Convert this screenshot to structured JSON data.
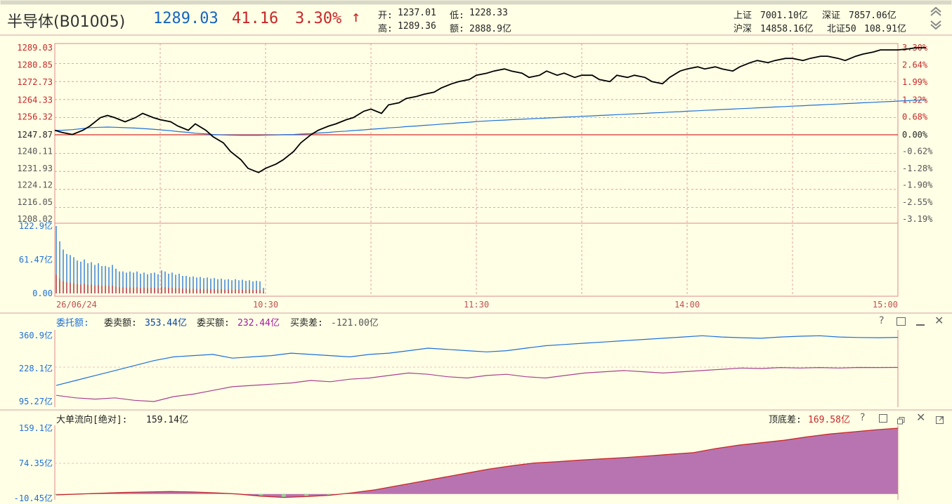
{
  "header": {
    "name": "半导体(B01005)",
    "price": "1289.03",
    "change": "41.16",
    "change_pct": "3.30%",
    "arrow": "↑",
    "open_label": "开:",
    "open": "1237.01",
    "low_label": "低:",
    "low": "1228.33",
    "high_label": "高:",
    "high": "1289.36",
    "amount_label": "额:",
    "amount": "2888.9亿",
    "market": [
      {
        "label": "上证",
        "value": "7001.10亿"
      },
      {
        "label": "深证",
        "value": "7857.06亿"
      },
      {
        "label": "沪深",
        "value": "14858.16亿"
      },
      {
        "label": "北证50",
        "value": "108.91亿"
      }
    ]
  },
  "price_axis_left": [
    "1289.03",
    "1280.85",
    "1272.73",
    "1264.33",
    "1256.32",
    "1247.87",
    "1240.11",
    "1231.93",
    "1224.12",
    "1216.05",
    "1208.02"
  ],
  "price_axis_right": [
    "3.30%",
    "2.64%",
    "1.99%",
    "1.32%",
    "0.68%",
    "0.00%",
    "-0.62%",
    "-1.28%",
    "-1.90%",
    "-2.55%",
    "-3.19%"
  ],
  "volume_axis": [
    "122.9亿",
    "61.47亿",
    "0.00"
  ],
  "time_axis": [
    "26/06/24",
    "10:30",
    "11:30",
    "14:00",
    "15:00"
  ],
  "colors": {
    "price_line": "#000000",
    "avg_line": "#1E6FD9",
    "rise": "#D32F2F",
    "grid": "#E08A8A",
    "bg": "#FFFFE6",
    "vol_blue": "#1E6FD9",
    "vol_red": "#C62828",
    "sell": "#1E6FD9",
    "buy": "#A8428C",
    "flow_fill": "#B874B0",
    "flow_line": "#C62828",
    "flow_neg": "#9BCB9B"
  },
  "panel1": {
    "title": "委托额:",
    "sell_label": "委卖额:",
    "sell_value": "353.44亿",
    "buy_label": "委买额:",
    "buy_value": "232.44亿",
    "diff_label": "买卖差:",
    "diff_value": "-121.00亿",
    "axis": [
      "360.9亿",
      "228.1亿",
      "95.27亿"
    ]
  },
  "panel2": {
    "title": "大单流向[绝对]:",
    "value": "159.14亿",
    "peak_label": "顶底差:",
    "peak_value": "169.58亿",
    "axis": [
      "159.1亿",
      "74.35亿",
      "-10.45亿"
    ]
  },
  "chart_data": [
    {
      "type": "line",
      "title": "半导体(B01005)",
      "xlabel": "",
      "ylabel": "",
      "ylim": [
        1208.02,
        1289.03
      ],
      "x_minutes_from_open": [
        0,
        2,
        5,
        8,
        10,
        13,
        15,
        17,
        20,
        23,
        25,
        28,
        30,
        33,
        35,
        38,
        40,
        43,
        45,
        48,
        50,
        53,
        55,
        58,
        60,
        63,
        65,
        68,
        70,
        73,
        75,
        78,
        80,
        83,
        85,
        88,
        90,
        93,
        95,
        98,
        100,
        103,
        105,
        108,
        110,
        113,
        115,
        118,
        120,
        123,
        125,
        128,
        130,
        133,
        135,
        138,
        140,
        143,
        145,
        148,
        150,
        153,
        155,
        158,
        160,
        163,
        165,
        168,
        170,
        173,
        175,
        178,
        180,
        183,
        185,
        188,
        190,
        193,
        195,
        198,
        200,
        203,
        205,
        208,
        210,
        213,
        215,
        218,
        220,
        223,
        225,
        228,
        230,
        233,
        235,
        238,
        240,
        243,
        245,
        248
      ],
      "series": [
        {
          "name": "",
          "values": [
            1250.0,
            1249.0,
            1248.0,
            1250.0,
            1252.0,
            1256.0,
            1257.0,
            1256.0,
            1254.0,
            1256.0,
            1258.0,
            1256.0,
            1255.0,
            1254.0,
            1252.0,
            1250.0,
            1253.0,
            1250.0,
            1247.0,
            1244.0,
            1240.0,
            1236.0,
            1232.0,
            1230.0,
            1232.0,
            1234.0,
            1236.0,
            1240.0,
            1244.0,
            1248.0,
            1250.0,
            1252.0,
            1253.0,
            1255.0,
            1256.0,
            1259.0,
            1260.0,
            1258.0,
            1262.0,
            1263.0,
            1265.0,
            1266.0,
            1267.0,
            1268.0,
            1270.0,
            1272.0,
            1273.0,
            1274.0,
            1276.0,
            1277.0,
            1278.0,
            1279.0,
            1278.0,
            1277.0,
            1275.0,
            1276.0,
            1278.0,
            1276.0,
            1277.0,
            1275.0,
            1276.0,
            1276.0,
            1274.0,
            1273.0,
            1276.0,
            1275.0,
            1276.0,
            1275.0,
            1273.0,
            1272.0,
            1275.0,
            1278.0,
            1279.0,
            1280.0,
            1279.0,
            1280.0,
            1279.0,
            1278.0,
            1280.0,
            1282.0,
            1283.0,
            1282.0,
            1283.0,
            1284.0,
            1284.0,
            1283.0,
            1284.0,
            1285.0,
            1285.0,
            1284.0,
            1283.0,
            1285.0,
            1286.0,
            1287.0,
            1288.0,
            1288.0,
            1288.0,
            1288.5,
            1289.0,
            1289.03
          ]
        },
        {
          "name": "",
          "values": [
            1250.0,
            1250.0,
            1250.3,
            1250.8,
            1251.2,
            1251.4,
            1251.5,
            1251.4,
            1251.2,
            1251.0,
            1250.8,
            1250.5,
            1250.2,
            1249.8,
            1249.4,
            1249.0,
            1248.6,
            1248.3,
            1248.0,
            1247.8,
            1247.7,
            1247.6,
            1247.6,
            1247.6,
            1247.7,
            1247.8,
            1247.9,
            1248.0,
            1248.2,
            1248.4,
            1248.7,
            1249.0,
            1249.3,
            1249.6,
            1249.9,
            1250.2,
            1250.5,
            1250.8,
            1251.1,
            1251.4,
            1251.7,
            1252.0,
            1252.3,
            1252.6,
            1252.9,
            1253.2,
            1253.5,
            1253.8,
            1254.1,
            1254.4,
            1254.6,
            1254.8,
            1255.0,
            1255.2,
            1255.4,
            1255.6,
            1255.8,
            1256.0,
            1256.2,
            1256.4,
            1256.6,
            1256.8,
            1257.0,
            1257.2,
            1257.4,
            1257.6,
            1257.8,
            1258.0,
            1258.2,
            1258.4,
            1258.6,
            1258.8,
            1259.0,
            1259.2,
            1259.4,
            1259.6,
            1259.8,
            1260.0,
            1260.2,
            1260.4,
            1260.6,
            1260.8,
            1261.0,
            1261.2,
            1261.4,
            1261.6,
            1261.8,
            1262.0,
            1262.2,
            1262.4,
            1262.6,
            1262.8,
            1263.0,
            1263.2,
            1263.4,
            1263.6,
            1263.8,
            1264.0,
            1264.2,
            1264.4
          ]
        }
      ]
    },
    {
      "type": "bar",
      "ylim": [
        0,
        122.9
      ],
      "series": [
        {
          "name": "",
          "values": [
            122.9,
            95,
            80,
            72,
            70,
            66,
            60,
            58,
            62,
            55,
            57,
            52,
            55,
            50,
            50,
            48,
            52,
            45,
            40,
            40,
            38,
            40,
            38,
            40,
            36,
            38,
            35,
            37,
            38,
            35,
            42,
            40,
            36,
            38,
            34,
            36,
            32,
            32,
            30,
            31,
            29,
            30,
            28,
            29,
            27,
            28,
            26,
            27,
            25,
            26,
            24,
            26,
            24,
            25,
            23,
            24,
            22,
            23,
            22,
            10
          ]
        }
      ]
    },
    {
      "type": "line",
      "ylim": [
        95.27,
        360.9
      ],
      "series": [
        {
          "name": "委卖额",
          "values": [
            160,
            180,
            200,
            220,
            240,
            260,
            275,
            280,
            285,
            270,
            275,
            280,
            290,
            285,
            280,
            275,
            285,
            290,
            300,
            310,
            305,
            300,
            295,
            300,
            310,
            320,
            325,
            330,
            335,
            340,
            345,
            350,
            355,
            360,
            355,
            352,
            350,
            355,
            358,
            360,
            355,
            353,
            352,
            353.44
          ]
        },
        {
          "name": "委买额",
          "values": [
            120,
            110,
            105,
            110,
            100,
            95.27,
            115,
            125,
            140,
            155,
            160,
            165,
            170,
            180,
            175,
            185,
            190,
            200,
            210,
            205,
            195,
            190,
            200,
            205,
            195,
            190,
            200,
            210,
            215,
            220,
            215,
            210,
            215,
            220,
            225,
            230,
            228,
            232,
            230,
            232,
            230,
            232.44,
            232,
            232.44
          ]
        }
      ]
    },
    {
      "type": "area",
      "ylim": [
        -10.45,
        159.1
      ],
      "series": [
        {
          "name": "大单流向",
          "values": [
            -2,
            0,
            2,
            4,
            5,
            6,
            5,
            3,
            0,
            -5,
            -8,
            -6,
            -3,
            3,
            10,
            20,
            30,
            40,
            50,
            60,
            68,
            75,
            78,
            82,
            85,
            88,
            92,
            96,
            100,
            110,
            118,
            124,
            130,
            138,
            145,
            150,
            155,
            159.14
          ]
        }
      ]
    }
  ]
}
